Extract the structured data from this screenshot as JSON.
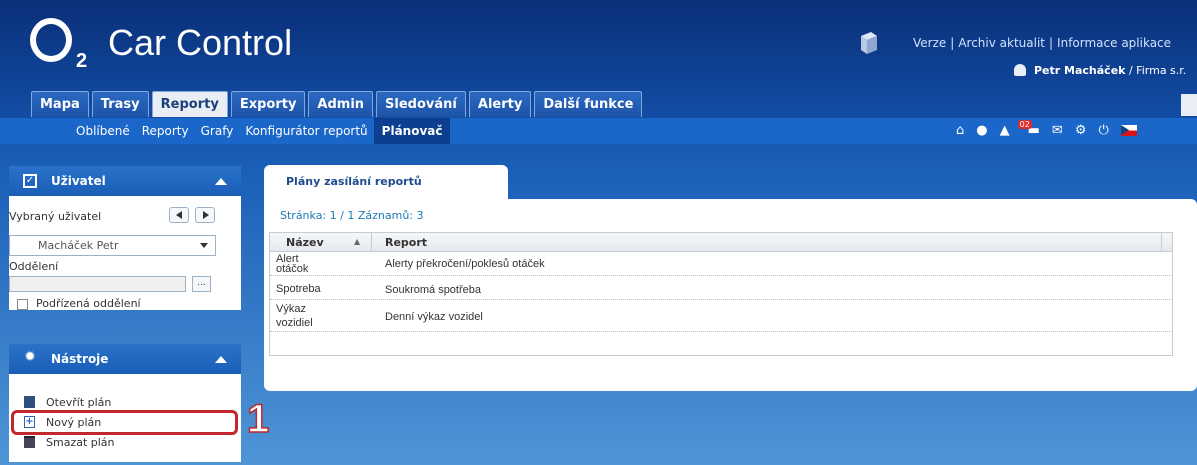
{
  "app": {
    "logo_letter": "O",
    "logo_sub": "2",
    "title": "Car Control"
  },
  "toplinks": [
    "Verze",
    "Archiv aktualit",
    "Informace aplikace"
  ],
  "user": {
    "name": "Petr Macháček",
    "company": "/ Firma s.r."
  },
  "tabs": [
    {
      "label": "Mapa",
      "active": false
    },
    {
      "label": "Trasy",
      "active": false
    },
    {
      "label": "Reporty",
      "active": true
    },
    {
      "label": "Exporty",
      "active": false
    },
    {
      "label": "Admin",
      "active": false
    },
    {
      "label": "Sledování",
      "active": false
    },
    {
      "label": "Alerty",
      "active": false
    },
    {
      "label": "Další funkce",
      "active": false
    }
  ],
  "subnav": [
    {
      "label": "Oblíbené",
      "active": false
    },
    {
      "label": "Reporty",
      "active": false
    },
    {
      "label": "Grafy",
      "active": false
    },
    {
      "label": "Konfigurátor reportů",
      "active": false
    },
    {
      "label": "Plánovač",
      "active": true
    }
  ],
  "toolbar_badge": "02",
  "user_panel": {
    "title": "Uživatel",
    "selected_user_label": "Vybraný uživatel",
    "selected_user_value": "Macháček Petr",
    "department_label": "Oddělení",
    "department_value": "",
    "dots": "...",
    "subdepartments_label": "Podřízená oddělení"
  },
  "tools_panel": {
    "title": "Nástroje",
    "items": [
      "Otevřít plán",
      "Nový plán",
      "Smazat plán"
    ]
  },
  "annotation": {
    "step": "1"
  },
  "main": {
    "tab_title": "Plány zasílání reportů",
    "pager": "Stránka: 1 / 1  Záznamů: 3",
    "columns": [
      "Název",
      "Report"
    ],
    "rows": [
      {
        "name_line1": "Alert",
        "name_line2": "otáčok",
        "report": "Alerty překročení/poklesů otáček"
      },
      {
        "name_line1": "Spotreba",
        "name_line2": "",
        "report": "Soukromá spotřeba"
      },
      {
        "name_line1": "Výkaz",
        "name_line2": "vozidiel",
        "report": "Denní výkaz vozidel"
      }
    ]
  }
}
